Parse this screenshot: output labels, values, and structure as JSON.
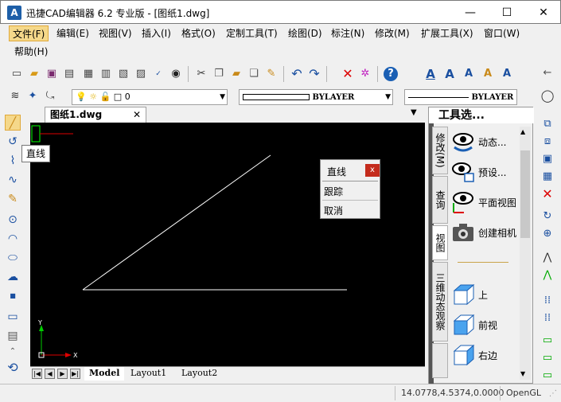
{
  "window": {
    "title": "迅捷CAD编辑器 6.2 专业版 - [图纸1.dwg]",
    "app_icon_text": "A",
    "minimize": "—",
    "maximize": "☐",
    "close": "✕"
  },
  "menu": {
    "items": [
      "文件(F)",
      "编辑(E)",
      "视图(V)",
      "插入(I)",
      "格式(O)",
      "定制工具(T)",
      "绘图(D)",
      "标注(N)",
      "修改(M)",
      "扩展工具(X)",
      "窗口(W)",
      "帮助(H)"
    ]
  },
  "layer_toolbar": {
    "layer_value": "0",
    "color_value": "BYLAYER",
    "linetype_value": "BYLAYER"
  },
  "document_tab": {
    "label": "图纸1.dwg",
    "close": "✕",
    "dropdown": "▼"
  },
  "tooltip": {
    "text": "直线"
  },
  "popup": {
    "title": "直线",
    "close": "x",
    "items": [
      "跟踪",
      "取消"
    ]
  },
  "ucs": {
    "x_label": "X",
    "y_label": "Y"
  },
  "layout_tabs": [
    "Model",
    "Layout1",
    "Layout2"
  ],
  "tool_palette": {
    "title": "工具选...",
    "tabs": [
      "修改(M)",
      "查询",
      "视图",
      "三维动态观察"
    ],
    "items": [
      {
        "label": "动态..."
      },
      {
        "label": "预设..."
      },
      {
        "label": "平面视图"
      },
      {
        "label": "创建相机"
      },
      {
        "label": "上"
      },
      {
        "label": "前视"
      },
      {
        "label": "右边"
      }
    ]
  },
  "status": {
    "coords": "14.0778,4.5374,0.0000",
    "renderer": "OpenGL"
  }
}
